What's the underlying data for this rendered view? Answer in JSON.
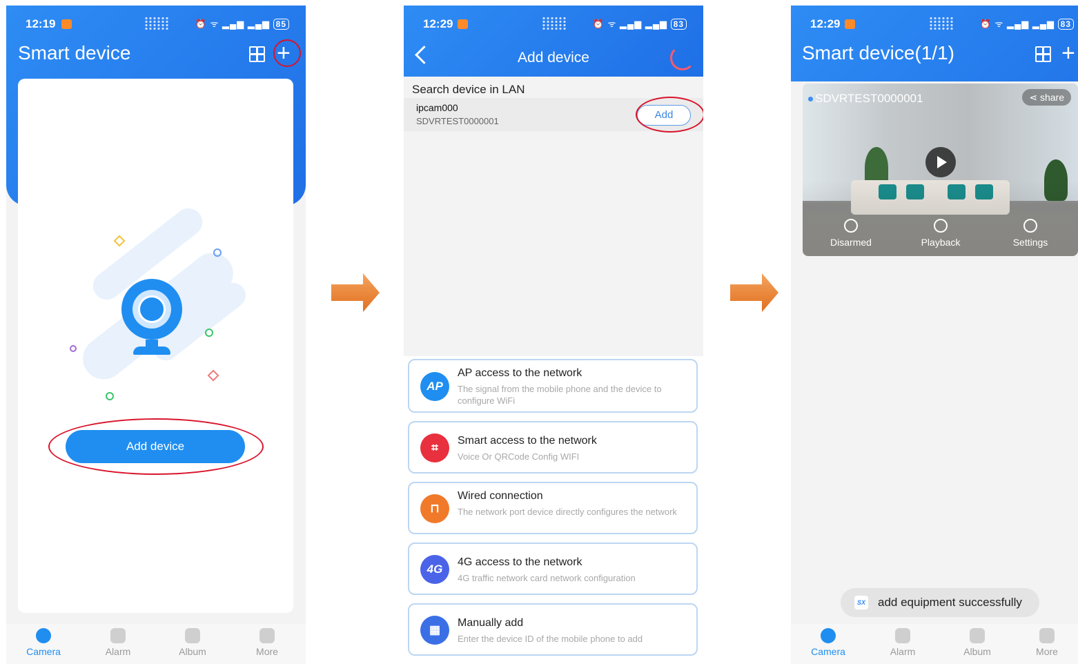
{
  "screen1": {
    "time": "12:19",
    "battery": "85",
    "title": "Smart device",
    "add_button": "Add device"
  },
  "screen2": {
    "time": "12:29",
    "battery": "83",
    "title": "Add device",
    "lan_label": "Search device in LAN",
    "lan_device": {
      "name": "ipcam000",
      "id": "SDVRTEST0000001",
      "add_label": "Add"
    },
    "options": [
      {
        "icon": "AP",
        "title": "AP access to the network",
        "desc": "The signal from the mobile phone and the device to configure WiFi",
        "color": "#1f8ef0"
      },
      {
        "icon": "qr-scan-icon",
        "title": "Smart access to the network",
        "desc": "Voice Or QRCode Config WIFI",
        "color": "#e8303e"
      },
      {
        "icon": "ethernet-icon",
        "title": "Wired connection",
        "desc": "The network port device directly configures the network",
        "color": "#f07a2a"
      },
      {
        "icon": "4G",
        "title": "4G access to the network",
        "desc": "4G traffic network card network configuration",
        "color": "#4a63e8"
      },
      {
        "icon": "manual-add-icon",
        "title": "Manually add",
        "desc": "Enter the device ID of the mobile phone to add",
        "color": "#3a6fe6"
      }
    ]
  },
  "screen3": {
    "time": "12:29",
    "battery": "83",
    "title": "Smart device(1/1)",
    "device_name": "SDVRTEST0000001",
    "share_label": "share",
    "controls": [
      "Disarmed",
      "Playback",
      "Settings"
    ],
    "toast": "add equipment successfully"
  },
  "tabs": [
    "Camera",
    "Alarm",
    "Album",
    "More"
  ],
  "colors": {
    "primary": "#1f8ef0",
    "highlight_ring": "#d9142b",
    "arrow": "#f08a3c"
  }
}
